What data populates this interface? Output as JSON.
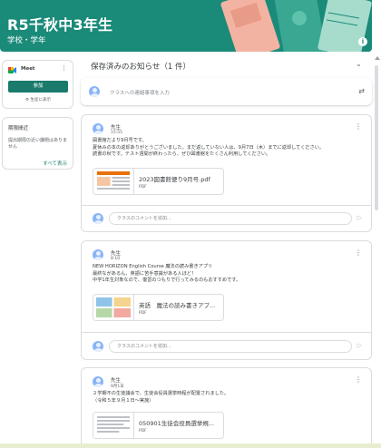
{
  "banner": {
    "title": "R5千秋中3年生",
    "subtitle": "学校・学年",
    "info_icon": "info-icon"
  },
  "meet": {
    "label": "Meet",
    "join_label": "参加",
    "settings_label": "⚙ 生徒に表示"
  },
  "upcoming": {
    "title": "期限間近",
    "text": "提出期限の近い課題はありません",
    "view_all": "すべて表示"
  },
  "saved": {
    "title": "保存済みのお知らせ（1 件）"
  },
  "share": {
    "placeholder": "クラスへの連絡事項を入力"
  },
  "posts": [
    {
      "author": "先生",
      "date": "15:55",
      "lines": [
        "図書館だより9月号です。",
        "夏休みの本の返却ありがとうございました。まだ返していない人は、9月7日（木）までに返却してください。",
        "読書の秋です。テスト週間が終わったら、ぜひ図書館をたくさん利用してください。"
      ],
      "attachment": {
        "name": "2023図書館便り9月号.pdf",
        "type": "PDF"
      },
      "comment_placeholder": "クラスのコメントを追加..."
    },
    {
      "author": "先生",
      "date": "8:10",
      "lines": [
        "NEW HORIZON English Course 魔法の読み書きアプリ",
        "最終ながあるん、英語に苦手意識がある人ほど！",
        "中学1年生対象なので、復習のつもりで行ってみるのもおすすめです。"
      ],
      "attachment": {
        "name": "英語　魔法の読み書きアプ...",
        "type": "PDF"
      },
      "comment_placeholder": "クラスのコメントを追加..."
    },
    {
      "author": "先生",
      "date": "9月1日",
      "lines": [
        "２学期不の生徒議会で、生徒会役員選挙時程が配置されました。",
        "（令和５年９月１日〜実施）"
      ],
      "attachment": {
        "name": "050901生徒会役員選挙規...",
        "type": "PDF"
      }
    }
  ]
}
